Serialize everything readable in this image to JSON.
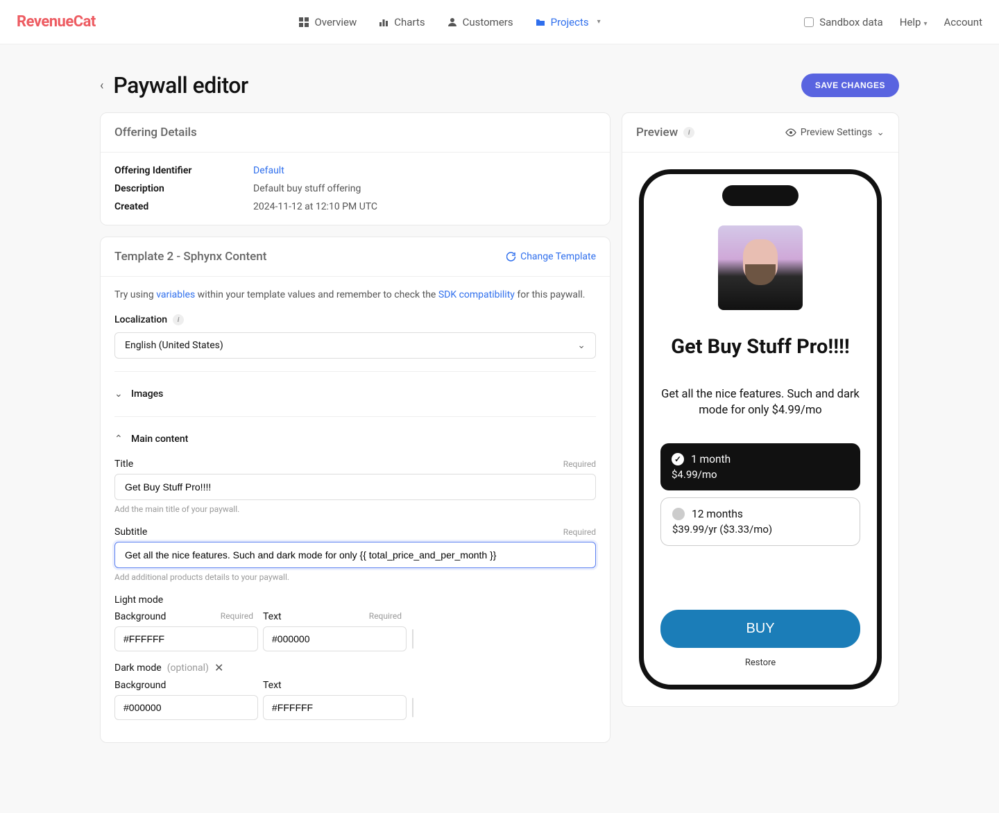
{
  "brand": "RevenueCat",
  "nav": {
    "overview": "Overview",
    "charts": "Charts",
    "customers": "Customers",
    "projects": "Projects"
  },
  "topright": {
    "sandbox": "Sandbox data",
    "help": "Help",
    "account": "Account"
  },
  "page": {
    "title": "Paywall editor",
    "save": "SAVE CHANGES"
  },
  "offering": {
    "header": "Offering Details",
    "id_label": "Offering Identifier",
    "id_value": "Default",
    "desc_label": "Description",
    "desc_value": "Default buy stuff offering",
    "created_label": "Created",
    "created_value": "2024-11-12 at 12:10 PM UTC"
  },
  "template": {
    "header": "Template 2 - Sphynx Content",
    "change": "Change Template",
    "hint_pre": "Try using ",
    "hint_vars": "variables",
    "hint_mid": " within your template values and remember to check the ",
    "hint_sdk": "SDK compatibility",
    "hint_post": " for this paywall.",
    "localization_label": "Localization",
    "locale": "English (United States)",
    "images_label": "Images",
    "main_label": "Main content"
  },
  "fields": {
    "title_label": "Title",
    "title_value": "Get Buy Stuff Pro!!!!",
    "title_help": "Add the main title of your paywall.",
    "required": "Required",
    "subtitle_label": "Subtitle",
    "subtitle_value": "Get all the nice features. Such and dark mode for only {{ total_price_and_per_month }}",
    "subtitle_help": "Add additional products details to your paywall.",
    "light_mode": "Light mode",
    "dark_mode": "Dark mode",
    "optional": "(optional)",
    "bg_label": "Background",
    "text_label": "Text",
    "light_bg": "#FFFFFF",
    "light_text": "#000000",
    "dark_bg": "#000000",
    "dark_text": "#FFFFFF"
  },
  "preview": {
    "header": "Preview",
    "settings": "Preview Settings",
    "title": "Get Buy Stuff Pro!!!!",
    "subtitle": "Get all the nice features. Such and dark mode for only $4.99/mo",
    "pkg1_name": "1 month",
    "pkg1_price": "$4.99/mo",
    "pkg2_name": "12 months",
    "pkg2_price": "$39.99/yr ($3.33/mo)",
    "buy": "BUY",
    "restore": "Restore"
  }
}
